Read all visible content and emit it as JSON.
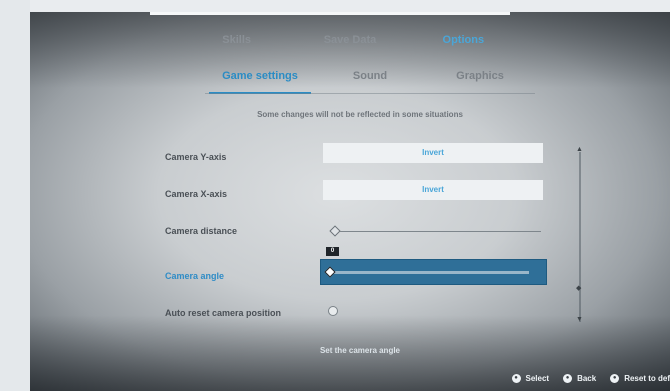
{
  "top_tabs": [
    {
      "label": "Skills"
    },
    {
      "label": "Save Data"
    },
    {
      "label": "Options"
    }
  ],
  "sub_tabs": [
    {
      "label": "Game settings"
    },
    {
      "label": "Sound"
    },
    {
      "label": "Graphics"
    }
  ],
  "notice": "Some changes will not be reflected in some situations",
  "settings": {
    "camera_y": {
      "label": "Camera Y-axis",
      "value": "Invert"
    },
    "camera_x": {
      "label": "Camera X-axis",
      "value": "Invert"
    },
    "camera_distance": {
      "label": "Camera distance",
      "level": 0
    },
    "camera_angle": {
      "label": "Camera angle",
      "value": "0",
      "level": 0
    },
    "auto_reset": {
      "label": "Auto reset camera position"
    }
  },
  "description": "Set the camera angle",
  "footer": {
    "select": "Select",
    "back": "Back",
    "reset": "Reset to def"
  },
  "colors": {
    "accent": "#4aa6d8",
    "highlight": "#2f6f98"
  }
}
